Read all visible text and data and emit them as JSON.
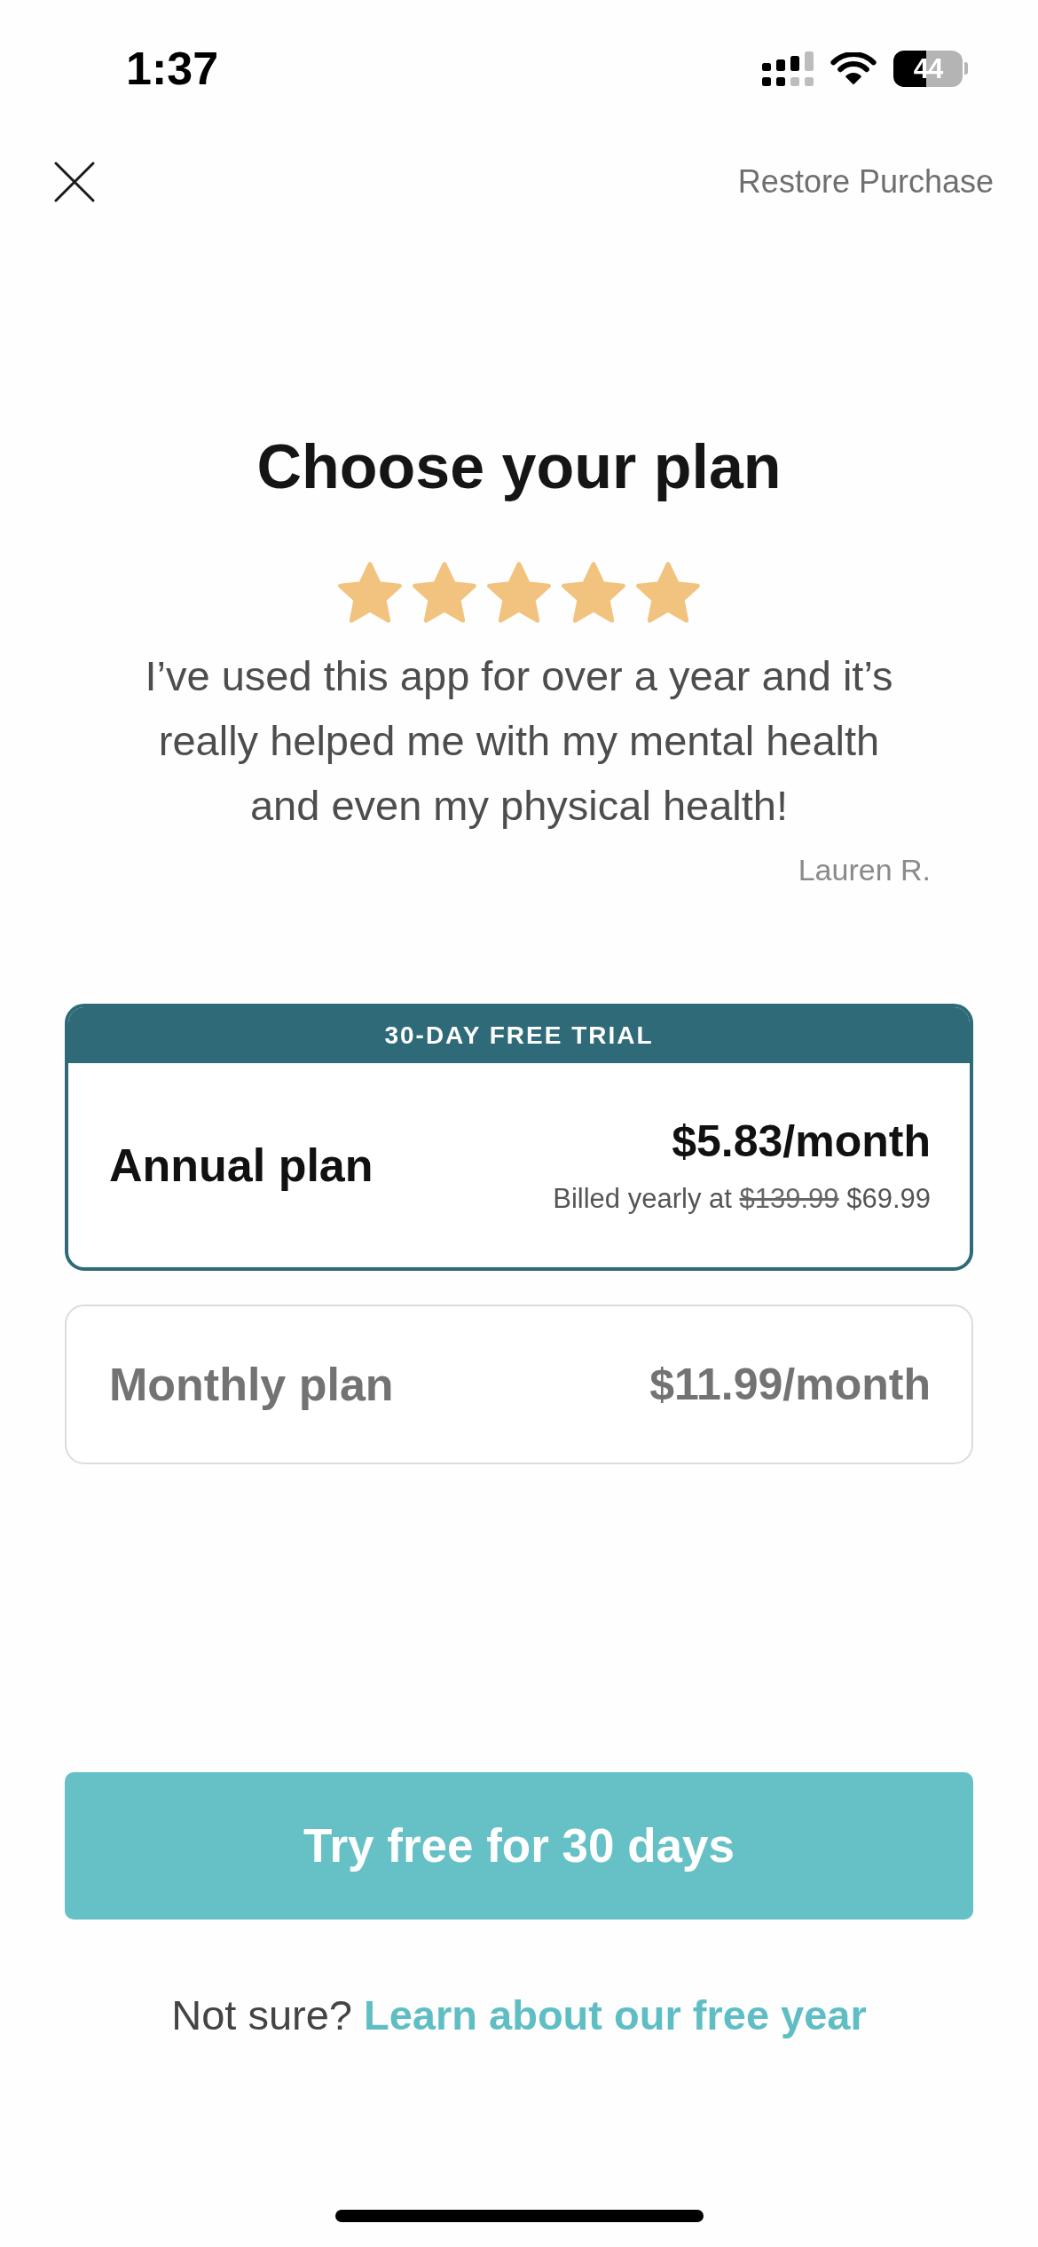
{
  "status_bar": {
    "time": "1:37",
    "battery": "44"
  },
  "header": {
    "restore_link": "Restore Purchase"
  },
  "title": "Choose your plan",
  "review": {
    "stars": 5,
    "quote": "I’ve used this app for over a year and it’s really helped me with my mental health and even my physical health!",
    "author": "Lauren R."
  },
  "plans": [
    {
      "name": "Annual plan",
      "badge": "30-DAY FREE TRIAL",
      "price": "$5.83/month",
      "billing": {
        "prefix": "Billed yearly at",
        "old_price": "$139.99",
        "new_price": "$69.99"
      },
      "selected": true
    },
    {
      "name": "Monthly plan",
      "price": "$11.99/month",
      "selected": false
    }
  ],
  "cta": {
    "label": "Try free for 30 days"
  },
  "footer": {
    "prompt": "Not sure?",
    "link": "Learn about our free year"
  }
}
